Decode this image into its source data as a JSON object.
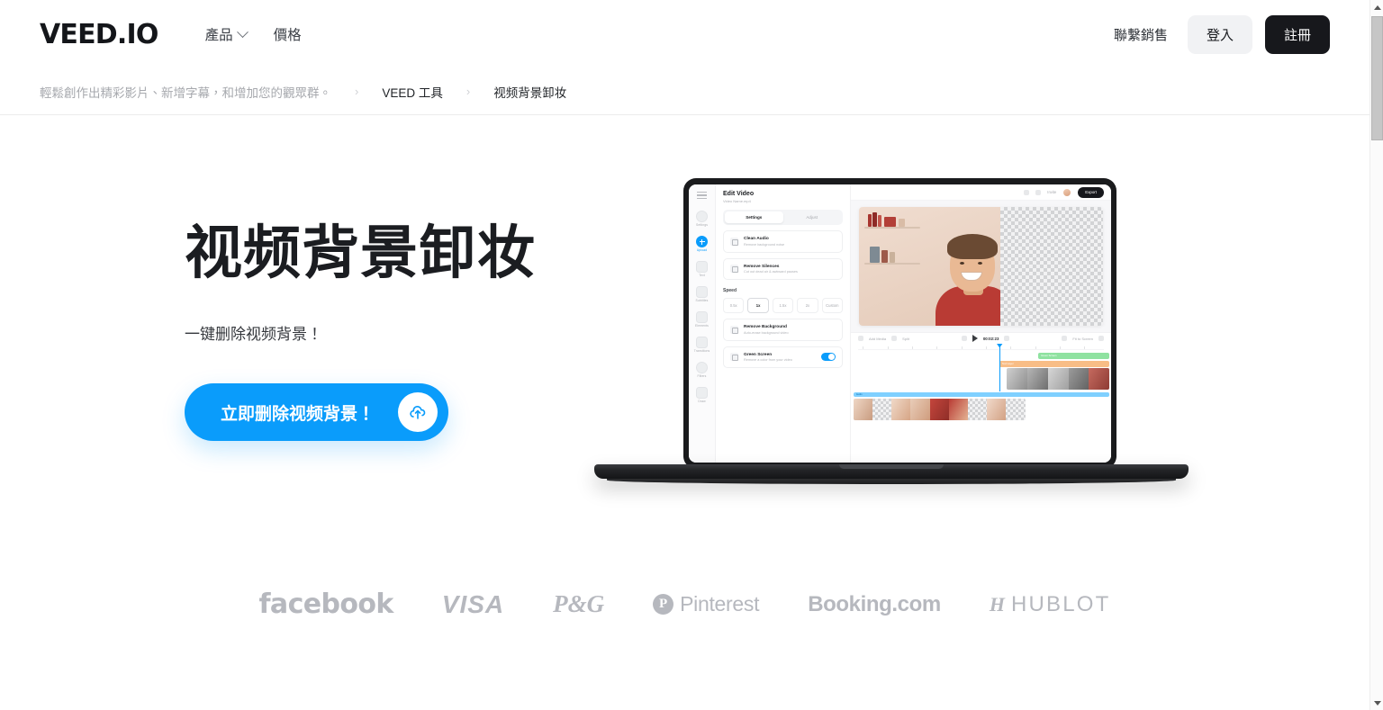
{
  "header": {
    "logo": "VEED.IO",
    "nav": [
      {
        "label": "產品",
        "has_dropdown": true
      },
      {
        "label": "價格",
        "has_dropdown": false
      }
    ],
    "contact_sales": "聯繫銷售",
    "login": "登入",
    "signup": "註冊"
  },
  "breadcrumb": {
    "tagline": "輕鬆創作出精彩影片、新增字幕，和增加您的觀眾群。",
    "separator": "›",
    "tools": "VEED 工具",
    "current": "视频背景卸妆"
  },
  "hero": {
    "title": "视频背景卸妆",
    "subtitle": "一键删除视频背景！",
    "cta_label": "立即删除视频背景！",
    "cta_icon": "cloud-upload-icon",
    "cta_color": "#0a9cfb"
  },
  "editor": {
    "rail": [
      {
        "label": "Settings",
        "icon": "gear-icon",
        "active": false
      },
      {
        "label": "Upload",
        "icon": "upload-plus-icon",
        "active": true
      },
      {
        "label": "Text",
        "icon": "text-icon",
        "active": false
      },
      {
        "label": "Subtitles",
        "icon": "subtitles-icon",
        "active": false
      },
      {
        "label": "Elements",
        "icon": "elements-icon",
        "active": false
      },
      {
        "label": "Transitions",
        "icon": "transitions-icon",
        "active": false
      },
      {
        "label": "Filters",
        "icon": "filters-icon",
        "active": false
      },
      {
        "label": "Draw",
        "icon": "pencil-icon",
        "active": false
      }
    ],
    "panel": {
      "title": "Edit Video",
      "file": "Video Name.mp4",
      "tabs": [
        {
          "label": "Settings",
          "active": true
        },
        {
          "label": "Adjust",
          "active": false
        }
      ],
      "options_top": [
        {
          "title": "Clean Audio",
          "desc": "Remove background noise",
          "icon": "sparkle-icon"
        },
        {
          "title": "Remove Silences",
          "desc": "Cut out dead air & awkward pauses",
          "icon": "waveform-icon"
        }
      ],
      "speed_label": "Speed",
      "speeds": [
        {
          "label": "0.5x",
          "active": false
        },
        {
          "label": "1x",
          "active": true
        },
        {
          "label": "1.5x",
          "active": false
        },
        {
          "label": "2x",
          "active": false
        },
        {
          "label": "Custom",
          "active": false
        }
      ],
      "options_bottom": [
        {
          "title": "Remove Background",
          "desc": "Auto-erase background video",
          "icon": "person-icon",
          "toggle": false
        },
        {
          "title": "Green Screen",
          "desc": "Remove a color from your video",
          "icon": "wand-icon",
          "toggle": true
        }
      ]
    },
    "topbar": {
      "undo": "undo-icon",
      "redo": "redo-icon",
      "invite": "Invite",
      "avatar": "avatar",
      "export": "Export"
    },
    "timeline": {
      "add_media": "Add Media",
      "split": "Split",
      "time": "00:02:23",
      "volume": "volume-icon",
      "fit": "Fit to Screen",
      "fullscreen": "fullscreen-icon",
      "clip_green": "Green Screen",
      "clip_orange": "Text Layer",
      "audio_label": "Audio"
    }
  },
  "logos": [
    {
      "name": "facebook"
    },
    {
      "name": "VISA"
    },
    {
      "name": "P&G"
    },
    {
      "name": "Pinterest"
    },
    {
      "name": "Booking.com"
    },
    {
      "name": "HUBLOT"
    }
  ],
  "scrollbar": {
    "up": "scroll-up-arrow",
    "down": "scroll-down-arrow"
  }
}
